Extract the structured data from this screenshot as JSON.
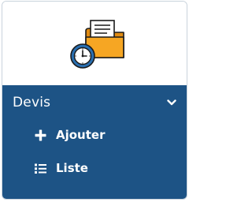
{
  "card": {
    "icon": "folder-with-document-and-clock-icon",
    "title": "Devis",
    "chevron_icon": "chevron-down-icon",
    "items": [
      {
        "label": "Ajouter",
        "icon": "plus-icon"
      },
      {
        "label": "Liste",
        "icon": "list-icon"
      }
    ]
  },
  "colors": {
    "panel": "#1d5385",
    "text": "#ffffff",
    "folder": "#f6a623",
    "folder_dark": "#e08b12",
    "clock": "#2a6fb0"
  }
}
